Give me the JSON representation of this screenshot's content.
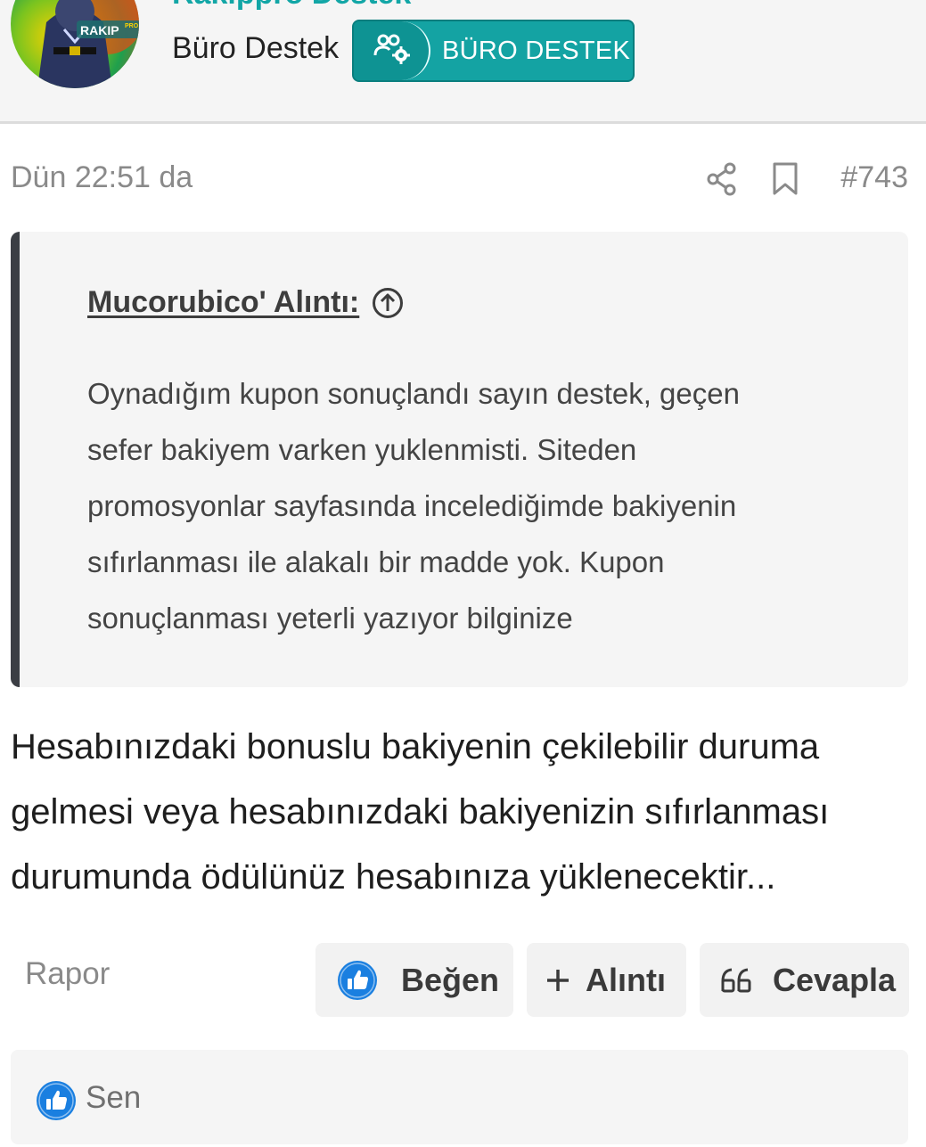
{
  "user": {
    "name": "Rakippro Destek",
    "title": "Büro Destek",
    "badge": "BÜRO DESTEK",
    "avatar_text": "RAKIP",
    "avatar_sup": "PRO"
  },
  "post": {
    "date": "Dün 22:51 da",
    "number": "#743"
  },
  "quote": {
    "author": "Mucorubico' Alıntı:",
    "lines": [
      "Oynadığım kupon sonuçlandı sayın destek, geçen",
      "sefer bakiyem varken yuklenmisti. Siteden",
      "promosyonlar sayfasında incelediğimde bakiyenin",
      "sıfırlanması ile alakalı bir madde yok. Kupon",
      "sonuçlanması yeterli yazıyor bilginize"
    ]
  },
  "message": {
    "lines": [
      "Hesabınızdaki bonuslu bakiyenin çekilebilir duruma",
      "gelmesi veya hesabınızdaki bakiyenizin sıfırlanması",
      "durumunda ödülünüz hesabınıza yüklenecektir..."
    ]
  },
  "actions": {
    "report": "Rapor",
    "like": "Beğen",
    "quote": "Alıntı",
    "reply": "Cevapla"
  },
  "reactions": {
    "user": "Sen"
  },
  "colors": {
    "accent": "#14a3a3",
    "like_blue": "#1a7fe0",
    "quote_border": "#3b3e44"
  }
}
